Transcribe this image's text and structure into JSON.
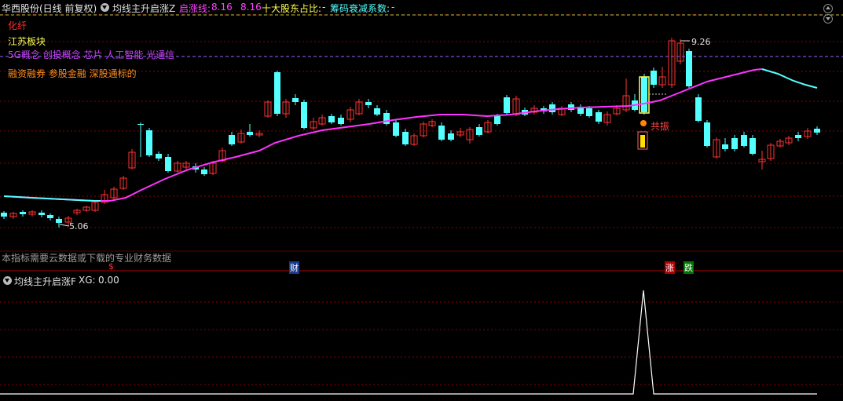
{
  "header": {
    "stock_title": "华西股份(日线 前复权)",
    "indicator_name": "均线主升启涨Z",
    "field1_label": "启涨线:",
    "field1_value1": "8.16",
    "field1_value2": "8.16",
    "field2_label": "十大股东占比:",
    "field2_value": "-",
    "field3_label": "筹码衰减系数:",
    "field3_value": "-"
  },
  "overlay_labels": {
    "industry": "化纤",
    "region": "江苏板块",
    "concepts1": "5G概念 创投概念 芯片 人工智能 光通信",
    "concepts2": "融资融券 参股金融 深股通标的"
  },
  "price_labels": {
    "high": "9.26",
    "low": "5.06"
  },
  "signal_label": "共振",
  "notice": "本指标需要云数据或下载的专业财务数据",
  "markers": {
    "dollar": "$",
    "finance": "财",
    "rise": "涨",
    "fall": "跌"
  },
  "sub_panel": {
    "indicator_name": "均线主升启涨F",
    "xg_label": "XG:",
    "xg_value": "0.00"
  },
  "colors": {
    "up": "#ff3232",
    "down": "#54ffff",
    "ma": "#ff33ff",
    "grid": "#8b0000",
    "xg": "#ffffff"
  },
  "chart_data": {
    "type": "candlestick",
    "high_price": 9.26,
    "low_price": 5.06,
    "ma_line": "启涨线",
    "xg_signal": [
      0,
      0,
      0,
      1,
      0
    ]
  }
}
